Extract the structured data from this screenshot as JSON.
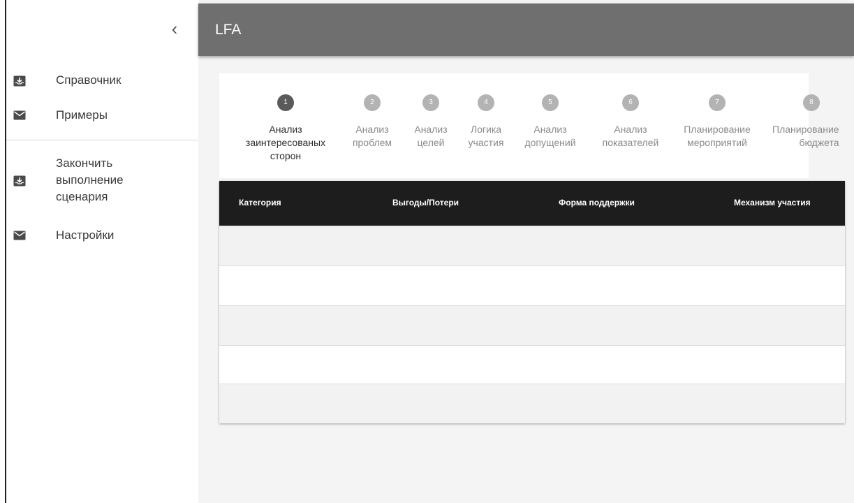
{
  "app": {
    "title": "LFA"
  },
  "sidebar": {
    "collapse_glyph": "‹",
    "items": [
      {
        "label": "Справочник",
        "icon": "inbox-download-icon"
      },
      {
        "label": "Примеры",
        "icon": "envelope-icon"
      },
      {
        "label": "Закончить\nвыполнение\nсценария",
        "icon": "inbox-download-icon"
      },
      {
        "label": "Настройки",
        "icon": "envelope-icon"
      }
    ]
  },
  "stepper": {
    "active": 1,
    "steps": [
      {
        "number": "1",
        "label": "Анализ\nзаинтересованых\nсторон"
      },
      {
        "number": "2",
        "label": "Анализ\nпроблем"
      },
      {
        "number": "3",
        "label": "Анализ\nцелей"
      },
      {
        "number": "4",
        "label": "Логика\nучастия"
      },
      {
        "number": "5",
        "label": "Анализ\nдопущений"
      },
      {
        "number": "6",
        "label": "Анализ\nпоказателей"
      },
      {
        "number": "7",
        "label": "Планирование\nмероприятий"
      },
      {
        "number": "8",
        "label": "Планирование\nбюджета"
      }
    ]
  },
  "table": {
    "columns": [
      "Категория",
      "Выгоды/Потери",
      "Форма поддержки",
      "Механизм участия"
    ],
    "rows": [
      [
        "",
        "",
        "",
        ""
      ],
      [
        "",
        "",
        "",
        ""
      ],
      [
        "",
        "",
        "",
        ""
      ],
      [
        "",
        "",
        "",
        ""
      ],
      [
        "",
        "",
        "",
        ""
      ]
    ]
  },
  "colors": {
    "header_bg": "#6f6f6f",
    "table_head_bg": "#1d1d1d",
    "step_active": "#5a5a5a",
    "step_inactive": "#b3b3b3"
  }
}
